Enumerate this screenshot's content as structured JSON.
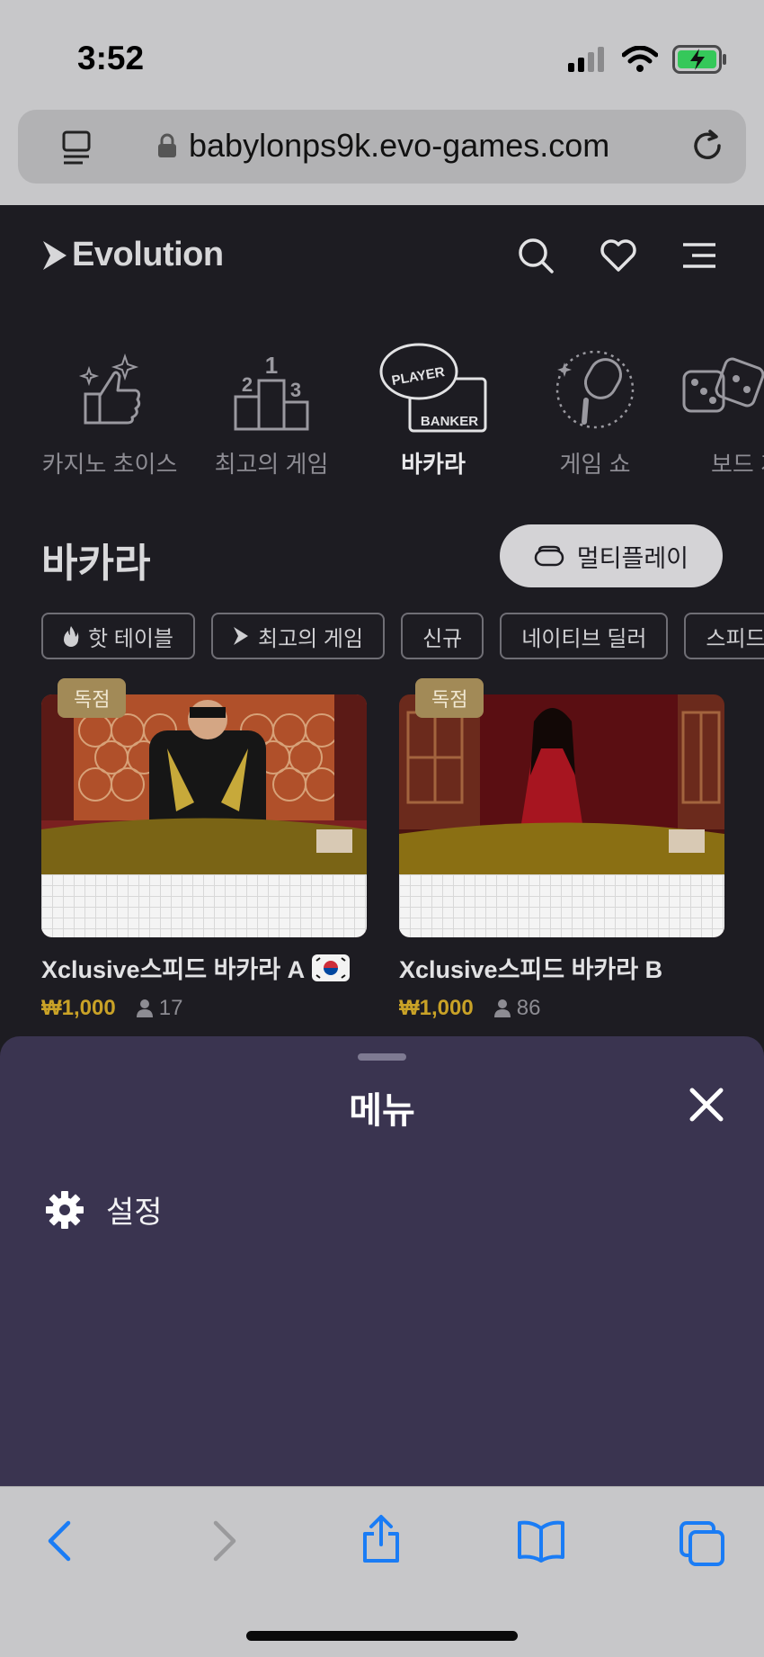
{
  "status": {
    "time": "3:52"
  },
  "browser": {
    "url": "babylonps9k.evo-games.com"
  },
  "header": {
    "logo": "Evolution"
  },
  "categories": [
    {
      "label": "카지노 초이스"
    },
    {
      "label": "최고의 게임"
    },
    {
      "label": "바카라",
      "icon_text_top": "PLAYER",
      "icon_text_bottom": "BANKER"
    },
    {
      "label": "게임 쇼"
    },
    {
      "label": "보드 게"
    }
  ],
  "podium": [
    "1",
    "2",
    "3"
  ],
  "section": {
    "title": "바카라",
    "multiplay_label": "멀티플레이"
  },
  "filters": [
    "핫 테이블",
    "최고의 게임",
    "신규",
    "네이티브 딜러",
    "스피드"
  ],
  "cards": [
    {
      "badge": "독점",
      "title": "Xclusive스피드 바카라 A",
      "price": "₩1,000",
      "players": "17",
      "flag": true
    },
    {
      "badge": "독점",
      "title": "Xclusive스피드 바카라 B",
      "price": "₩1,000",
      "players": "86",
      "flag": false
    }
  ],
  "menu": {
    "title": "메뉴",
    "items": [
      {
        "label": "설정",
        "icon": "gear-icon"
      }
    ]
  },
  "colors": {
    "accent_gold": "#c9a227",
    "sheet_bg": "#3a3450",
    "ios_blue": "#1a7cf5"
  }
}
